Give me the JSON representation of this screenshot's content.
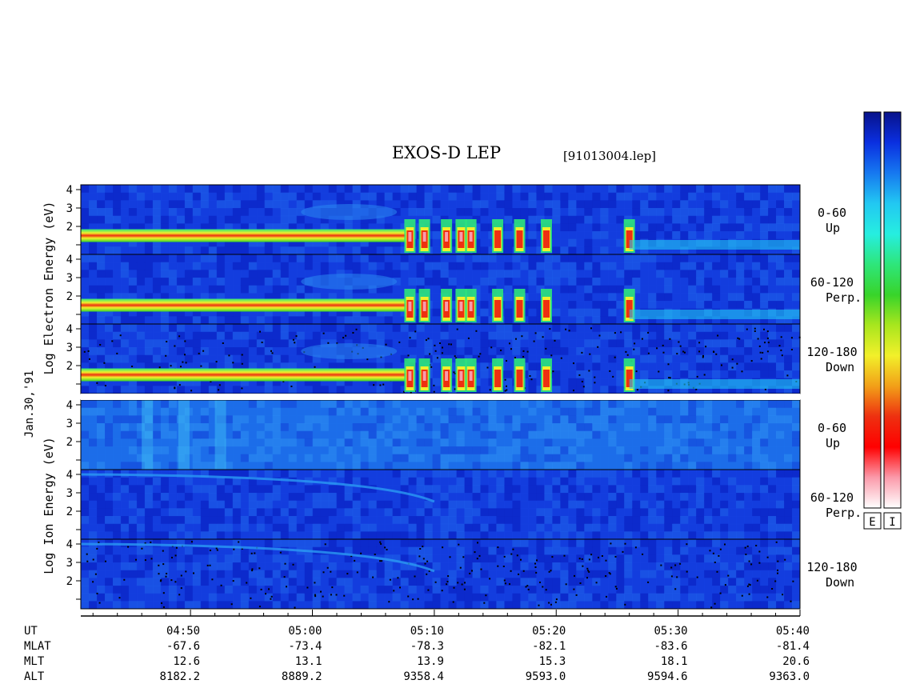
{
  "header": {
    "title": "EXOS-D LEP",
    "file": "[91013004.lep]"
  },
  "date_label": "Jan.30,'91",
  "groups": [
    {
      "ylabel_words": [
        "Log",
        "Electron",
        "Energy",
        "(eV)"
      ],
      "panels": [
        {
          "label1": "0-60",
          "label2": "Up"
        },
        {
          "label1": "60-120",
          "label2": "Perp."
        },
        {
          "label1": "120-180",
          "label2": "Down"
        }
      ]
    },
    {
      "ylabel_words": [
        "Log",
        "Ion",
        "Energy",
        "(eV)"
      ],
      "panels": [
        {
          "label1": "0-60",
          "label2": "Up"
        },
        {
          "label1": "60-120",
          "label2": "Perp."
        },
        {
          "label1": "120-180",
          "label2": "Down"
        }
      ]
    }
  ],
  "colorbars": [
    {
      "label": "E"
    },
    {
      "label": "I"
    }
  ],
  "colors": {
    "colormap": [
      "#08128a",
      "#0a2fe0",
      "#1678f0",
      "#22c8f2",
      "#26eee0",
      "#2ee67a",
      "#38d42a",
      "#a8e61e",
      "#f2f02a",
      "#f2a018",
      "#ee3010",
      "#ff0000",
      "#fb9aaa",
      "#ffffff"
    ]
  },
  "chart_data": {
    "type": "heatmap",
    "title": "EXOS-D LEP",
    "subtitle": "[91013004.lep]",
    "xlabel": "UT",
    "xlim": [
      "04:41",
      "05:40"
    ],
    "y_ticks": [
      "1",
      "2",
      "3",
      "4"
    ],
    "ylim": [
      1,
      4.2
    ],
    "x_ticks": [
      "04:50",
      "05:00",
      "05:10",
      "05:20",
      "05:30",
      "05:40"
    ],
    "orbit_rows": [
      {
        "label": "UT",
        "values": [
          "04:50",
          "05:00",
          "05:10",
          "05:20",
          "05:30",
          "05:40"
        ]
      },
      {
        "label": "MLAT",
        "values": [
          "-67.6",
          "-73.4",
          "-78.3",
          "-82.1",
          "-83.6",
          "-81.4"
        ]
      },
      {
        "label": "MLT",
        "values": [
          "12.6",
          "13.1",
          "13.9",
          "15.3",
          "18.1",
          "20.6"
        ]
      },
      {
        "label": "ALT",
        "values": [
          "8182.2",
          "8889.2",
          "9358.4",
          "9593.0",
          "9594.6",
          "9363.0"
        ]
      }
    ],
    "features": {
      "electron_band_energy_log_eV": 1.5,
      "electron_band_end_UT": "05:08",
      "burst_UT": [
        "05:08",
        "05:09",
        "05:11",
        "05:12",
        "05:13",
        "05:15",
        "05:17",
        "05:19",
        "05:26"
      ]
    },
    "grid": false,
    "legend": "colorbar-right"
  }
}
